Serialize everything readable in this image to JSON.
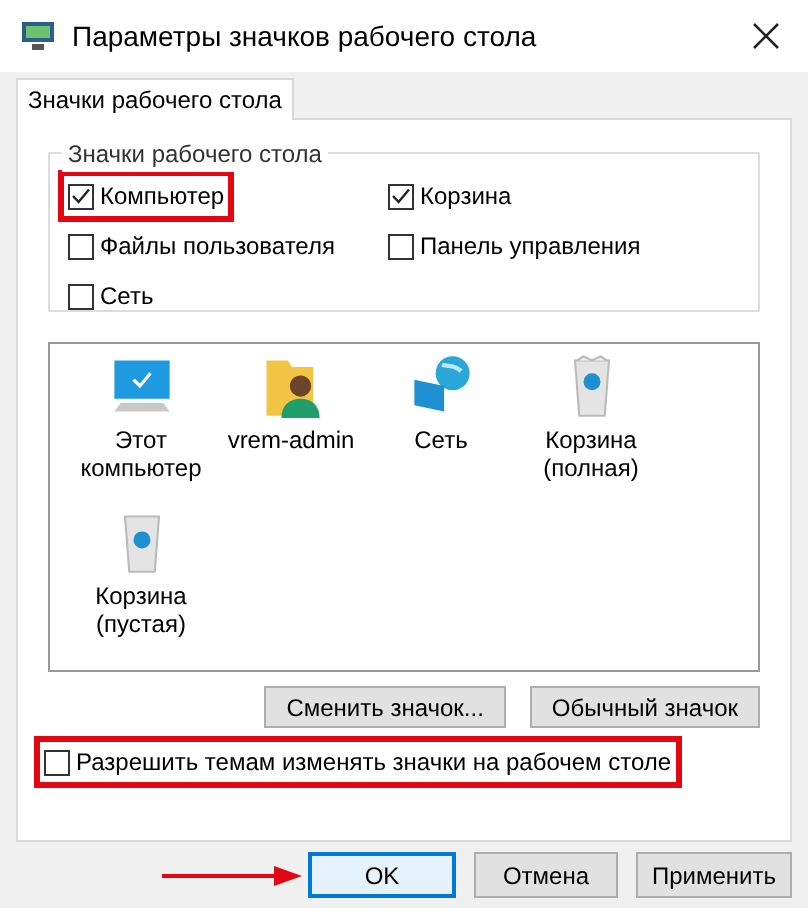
{
  "window": {
    "title": "Параметры значков рабочего стола"
  },
  "tabs": [
    {
      "label": "Значки рабочего стола",
      "selected": true
    }
  ],
  "group": {
    "title": "Значки рабочего стола",
    "checkboxes": [
      {
        "label": "Компьютер",
        "checked": true,
        "highlighted": true
      },
      {
        "label": "Корзина",
        "checked": true,
        "highlighted": false
      },
      {
        "label": "Файлы пользователя",
        "checked": false,
        "highlighted": false
      },
      {
        "label": "Панель управления",
        "checked": false,
        "highlighted": false
      },
      {
        "label": "Сеть",
        "checked": false,
        "highlighted": false
      }
    ]
  },
  "icons": [
    {
      "kind": "computer",
      "label": "Этот компьютер"
    },
    {
      "kind": "user",
      "label": "vrem-admin"
    },
    {
      "kind": "network",
      "label": "Сеть"
    },
    {
      "kind": "bin-full",
      "label": "Корзина (полная)"
    },
    {
      "kind": "bin-empty",
      "label": "Корзина (пустая)"
    }
  ],
  "icon_buttons": [
    "Сменить значок...",
    "Обычный значок"
  ],
  "allow_themes": {
    "label": "Разрешить темам изменять значки на рабочем столе",
    "checked": false,
    "highlighted": true
  },
  "buttons": [
    {
      "label": "OK",
      "default": true,
      "arrow": true
    },
    {
      "label": "Отмена",
      "default": false,
      "arrow": false
    },
    {
      "label": "Применить",
      "default": false,
      "arrow": false
    }
  ]
}
